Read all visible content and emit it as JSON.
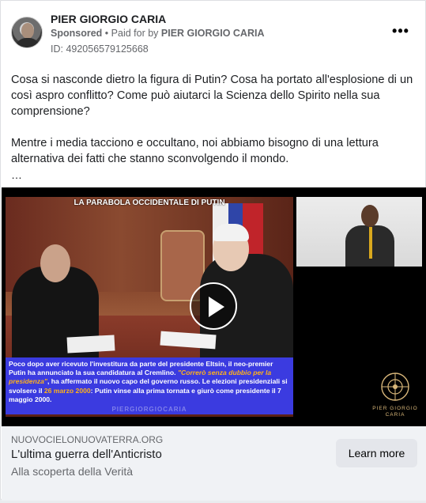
{
  "post": {
    "page_name": "PIER GIORGIO CARIA",
    "sponsored_label": "Sponsored",
    "separator": "•",
    "paid_for_text": "Paid for by",
    "payer_name": "PIER GIORGIO CARIA",
    "ad_id": "ID: 492056579125668",
    "more_label": "•••",
    "text_paragraph_1": "Cosa si nasconde dietro la figura di Putin? Cosa ha portato all'esplosione di un così aspro conflitto? Come può aiutarci la Scienza dello Spirito nella sua comprensione?",
    "text_paragraph_2": "Mentre i media tacciono e occultano, noi abbiamo bisogno di una lettura alternativa dei fatti che stanno sconvolgendo il mondo.",
    "ellipsis": "…"
  },
  "video": {
    "title_overlay": "LA PARABOLA OCCIDENTALE DI PUTIN",
    "caption_part_1": "Poco dopo aver ricevuto l'investitura da parte del presidente Eltsin, il neo-premier Putin ha annunciato la sua candidatura al Cremlino. ",
    "caption_quote": "\"Correrò senza dubbio per la presidenza\"",
    "caption_part_2": ", ha affermato il nuovo capo del governo russo. Le elezioni presidenziali si svolsero il ",
    "caption_date": "26 marzo 2000",
    "caption_part_3": ": Putin vinse alla prima tornata e giurò come presidente il 7 maggio 2000.",
    "watermark": "PIERGIORGIOCARIA",
    "logo_text_line1": "PIER GIORGIO",
    "logo_text_line2": "CARIA"
  },
  "link": {
    "domain": "NUOVOCIELONUOVATERRA.ORG",
    "headline": "L'ultima guerra dell'Anticristo",
    "description": "Alla scoperta della Verità",
    "cta_label": "Learn more"
  },
  "colors": {
    "caption_bg": "#3b3be0",
    "highlight": "#ffb21a",
    "footer_bg": "#f0f2f5",
    "cta_bg": "#e4e6eb"
  }
}
